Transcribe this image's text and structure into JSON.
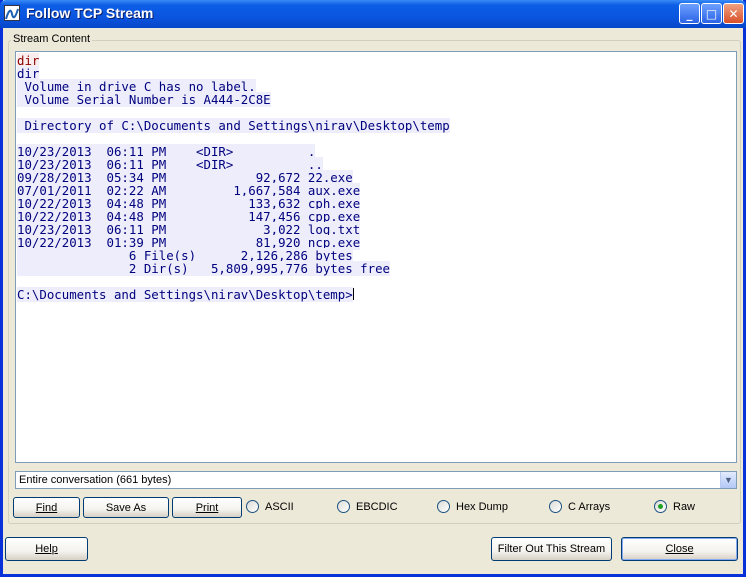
{
  "window": {
    "title": "Follow TCP Stream"
  },
  "stream": {
    "group_label": "Stream Content",
    "lines": [
      {
        "text": "dir",
        "dir": "sent"
      },
      {
        "text": "dir",
        "dir": "recv"
      },
      {
        "text": " Volume in drive C has no label.",
        "dir": "recv"
      },
      {
        "text": " Volume Serial Number is A444-2C8E",
        "dir": "recv"
      },
      {
        "text": "",
        "dir": "blank"
      },
      {
        "text": " Directory of C:\\Documents and Settings\\nirav\\Desktop\\temp",
        "dir": "recv"
      },
      {
        "text": "",
        "dir": "blank"
      },
      {
        "text": "10/23/2013  06:11 PM    <DIR>          .",
        "dir": "recv"
      },
      {
        "text": "10/23/2013  06:11 PM    <DIR>          ..",
        "dir": "recv"
      },
      {
        "text": "09/28/2013  05:34 PM            92,672 22.exe",
        "dir": "recv"
      },
      {
        "text": "07/01/2011  02:22 AM         1,667,584 aux.exe",
        "dir": "recv"
      },
      {
        "text": "10/22/2013  04:48 PM           133,632 cph.exe",
        "dir": "recv"
      },
      {
        "text": "10/22/2013  04:48 PM           147,456 cpp.exe",
        "dir": "recv"
      },
      {
        "text": "10/23/2013  06:11 PM             3,022 log.txt",
        "dir": "recv"
      },
      {
        "text": "10/22/2013  01:39 PM            81,920 ncp.exe",
        "dir": "recv"
      },
      {
        "text": "               6 File(s)      2,126,286 bytes",
        "dir": "recv"
      },
      {
        "text": "               2 Dir(s)   5,809,995,776 bytes free",
        "dir": "recv"
      },
      {
        "text": "",
        "dir": "blank"
      },
      {
        "text": "C:\\Documents and Settings\\nirav\\Desktop\\temp>",
        "dir": "recv"
      }
    ]
  },
  "conversation_select": {
    "selected": "Entire conversation (661 bytes)"
  },
  "toolbar": {
    "find": "Find",
    "save_as": "Save As",
    "print": "Print"
  },
  "format": {
    "options": [
      "ASCII",
      "EBCDIC",
      "Hex Dump",
      "C Arrays",
      "Raw"
    ],
    "selected": "Raw"
  },
  "footer": {
    "help": "Help",
    "filter_out": "Filter Out This Stream",
    "close": "Close"
  },
  "colors": {
    "sent_fg": "#8b0000",
    "sent_bg": "#fbeded",
    "recv_fg": "#00007f",
    "recv_bg": "#ededfb"
  }
}
